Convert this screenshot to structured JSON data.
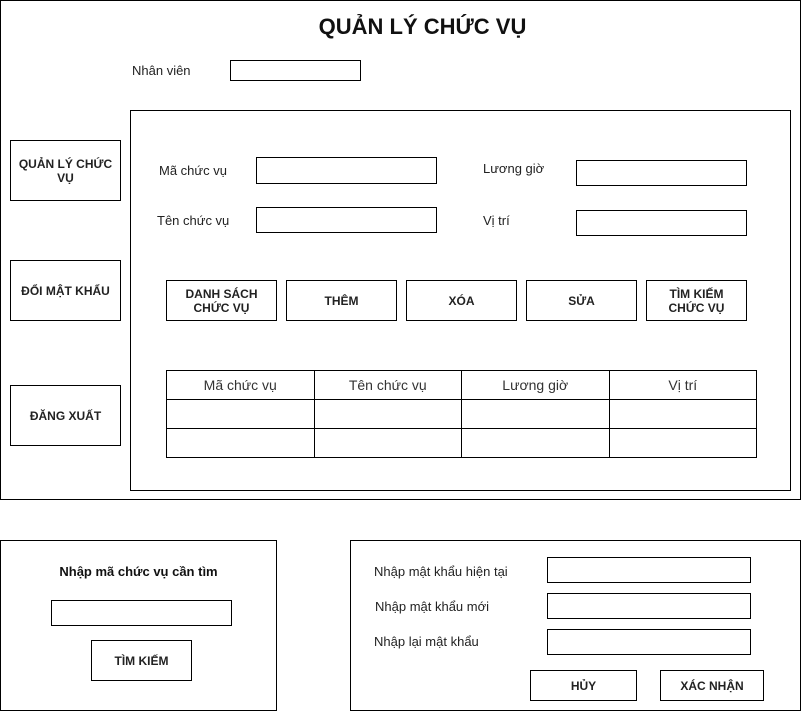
{
  "main": {
    "title": "QUẢN LÝ CHỨC VỤ",
    "employee_label": "Nhân viên",
    "employee_value": ""
  },
  "sidebar": {
    "items": [
      {
        "label": "QUẢN LÝ CHỨC VỤ"
      },
      {
        "label": "ĐỔI MẬT KHẨU"
      },
      {
        "label": "ĐĂNG XUẤT"
      }
    ]
  },
  "form": {
    "code_label": "Mã chức vụ",
    "name_label": "Tên chức vụ",
    "wage_label": "Lương giờ",
    "location_label": "Vị trí",
    "code_value": "",
    "name_value": "",
    "wage_value": "",
    "location_value": ""
  },
  "actions": {
    "list": "DANH SÁCH CHỨC VỤ",
    "add": "THÊM",
    "delete": "XÓA",
    "edit": "SỬA",
    "search": "TÌM KIẾM CHỨC VỤ"
  },
  "table": {
    "columns": [
      "Mã chức vụ",
      "Tên chức vụ",
      "Lương giờ",
      "Vị trí"
    ],
    "rows": [
      [
        "",
        "",
        "",
        ""
      ],
      [
        "",
        "",
        "",
        ""
      ]
    ]
  },
  "search_dialog": {
    "title": "Nhập mã chức vụ cần tìm",
    "input_value": "",
    "button": "TÌM KIẾM"
  },
  "password_dialog": {
    "current_label": "Nhập mật khẩu hiện tại",
    "new_label": "Nhập mật khẩu mới",
    "confirm_label": "Nhập lại mật khẩu",
    "cancel": "HỦY",
    "confirm": "XÁC NHẬN"
  }
}
